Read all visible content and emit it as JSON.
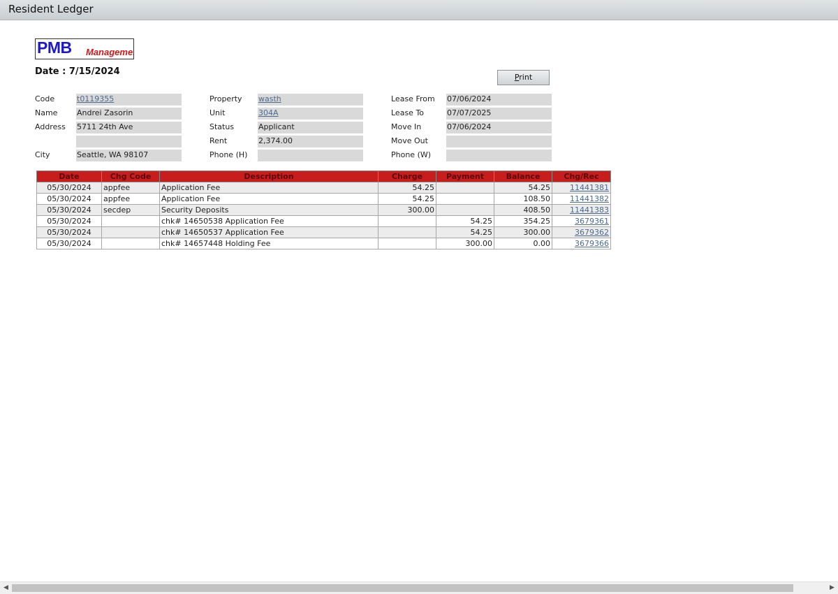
{
  "window": {
    "title": "Resident Ledger"
  },
  "logo": {
    "main": "PMB",
    "sub": "Management"
  },
  "header": {
    "date": "Date : 7/15/2024",
    "print_label": "Print",
    "print_access_key": "P",
    "print_rest": "rint"
  },
  "info": {
    "col1": [
      {
        "label": "Code",
        "value": "t0119355",
        "link": true
      },
      {
        "label": "Name",
        "value": "Andrei Zasorin"
      },
      {
        "label": "Address",
        "value": "5711 24th Ave"
      },
      {
        "label": "",
        "value": ""
      },
      {
        "label": "City",
        "value": "Seattle, WA 98107"
      }
    ],
    "col2": [
      {
        "label": "Property",
        "value": "wasth",
        "link": true
      },
      {
        "label": "Unit",
        "value": "304A",
        "link": true
      },
      {
        "label": "Status",
        "value": "Applicant"
      },
      {
        "label": "Rent",
        "value": "2,374.00"
      },
      {
        "label": "Phone (H)",
        "value": ""
      }
    ],
    "col3": [
      {
        "label": "Lease From",
        "value": "07/06/2024"
      },
      {
        "label": "Lease To",
        "value": "07/07/2025"
      },
      {
        "label": "Move In",
        "value": "07/06/2024"
      },
      {
        "label": "Move Out",
        "value": ""
      },
      {
        "label": "Phone (W)",
        "value": ""
      }
    ]
  },
  "ledger": {
    "columns": [
      "Date",
      "Chg Code",
      "Description",
      "Charge",
      "Payment",
      "Balance",
      "Chg/Rec"
    ],
    "rows": [
      {
        "date": "05/30/2024",
        "chg_code": "appfee",
        "description": "Application Fee",
        "charge": "54.25",
        "payment": "",
        "balance": "54.25",
        "chg_rec": "11441381"
      },
      {
        "date": "05/30/2024",
        "chg_code": "appfee",
        "description": "Application Fee",
        "charge": "54.25",
        "payment": "",
        "balance": "108.50",
        "chg_rec": "11441382"
      },
      {
        "date": "05/30/2024",
        "chg_code": "secdep",
        "description": "Security Deposits",
        "charge": "300.00",
        "payment": "",
        "balance": "408.50",
        "chg_rec": "11441383"
      },
      {
        "date": "05/30/2024",
        "chg_code": "",
        "description": "chk# 14650538 Application Fee",
        "charge": "",
        "payment": "54.25",
        "balance": "354.25",
        "chg_rec": "3679361"
      },
      {
        "date": "05/30/2024",
        "chg_code": "",
        "description": "chk# 14650537 Application Fee",
        "charge": "",
        "payment": "54.25",
        "balance": "300.00",
        "chg_rec": "3679362"
      },
      {
        "date": "05/30/2024",
        "chg_code": "",
        "description": "chk# 14657448 Holding Fee",
        "charge": "",
        "payment": "300.00",
        "balance": "0.00",
        "chg_rec": "3679366"
      }
    ]
  },
  "colors": {
    "table_header": "#c81d1d",
    "link": "#4a6a8f",
    "logo_blue": "#1e19c8",
    "logo_red": "#d41616"
  }
}
